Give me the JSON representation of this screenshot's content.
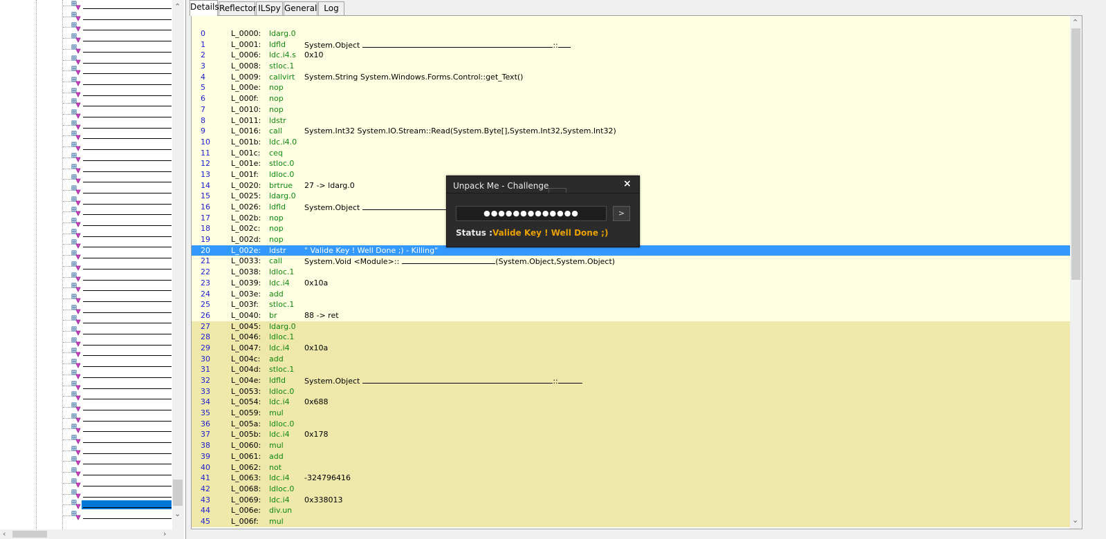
{
  "tabs": [
    {
      "label": "Details",
      "active": true
    },
    {
      "label": "Reflector",
      "active": false
    },
    {
      "label": "ILSpy",
      "active": false
    },
    {
      "label": "General",
      "active": false
    },
    {
      "label": "Log",
      "active": false
    }
  ],
  "tree": {
    "node_icon": "method-icon",
    "node_count": 48,
    "selected_index": 46
  },
  "colors": {
    "first_block": "#ffffe1",
    "second_block": "#eee8aa",
    "selected_row": "#3399ff",
    "opcode": "#118811",
    "index": "#1b1bd0",
    "status_value": "#e8a000"
  },
  "il_rows": [
    {
      "idx": "0",
      "label": "L_0000:",
      "op": "ldarg.0",
      "arg": ""
    },
    {
      "idx": "1",
      "label": "L_0001:",
      "op": "ldfld",
      "arg": "System.Object",
      "redact": [
        275,
        "::",
        18
      ]
    },
    {
      "idx": "2",
      "label": "L_0006:",
      "op": "ldc.i4.s",
      "arg": "0x10"
    },
    {
      "idx": "3",
      "label": "L_0008:",
      "op": "stloc.1",
      "arg": ""
    },
    {
      "idx": "4",
      "label": "L_0009:",
      "op": "callvirt",
      "arg": "System.String System.Windows.Forms.Control::get_Text()"
    },
    {
      "idx": "5",
      "label": "L_000e:",
      "op": "nop",
      "arg": ""
    },
    {
      "idx": "6",
      "label": "L_000f:",
      "op": "nop",
      "arg": ""
    },
    {
      "idx": "7",
      "label": "L_0010:",
      "op": "nop",
      "arg": ""
    },
    {
      "idx": "8",
      "label": "L_0011:",
      "op": "ldstr",
      "arg": ""
    },
    {
      "idx": "9",
      "label": "L_0016:",
      "op": "call",
      "arg": "System.Int32 System.IO.Stream::Read(System.Byte[],System.Int32,System.Int32)"
    },
    {
      "idx": "10",
      "label": "L_001b:",
      "op": "ldc.i4.0",
      "arg": ""
    },
    {
      "idx": "11",
      "label": "L_001c:",
      "op": "ceq",
      "arg": ""
    },
    {
      "idx": "12",
      "label": "L_001e:",
      "op": "stloc.0",
      "arg": ""
    },
    {
      "idx": "13",
      "label": "L_001f:",
      "op": "ldloc.0",
      "arg": ""
    },
    {
      "idx": "14",
      "label": "L_0020:",
      "op": "brtrue",
      "arg": "27 -> ldarg.0"
    },
    {
      "idx": "15",
      "label": "L_0025:",
      "op": "ldarg.0",
      "arg": ""
    },
    {
      "idx": "16",
      "label": "L_0026:",
      "op": "ldfld",
      "arg": "System.Object",
      "redact": [
        140,
        "",
        0
      ]
    },
    {
      "idx": "17",
      "label": "L_002b:",
      "op": "nop",
      "arg": ""
    },
    {
      "idx": "18",
      "label": "L_002c:",
      "op": "nop",
      "arg": ""
    },
    {
      "idx": "19",
      "label": "L_002d:",
      "op": "nop",
      "arg": ""
    },
    {
      "idx": "20",
      "label": "L_002e:",
      "op": "ldstr",
      "arg": "\"   Valide Key ! Well Done ;) - Killing\"",
      "selected": true
    },
    {
      "idx": "21",
      "label": "L_0033:",
      "op": "call",
      "arg": "System.Void <Module>::",
      "redact": [
        135,
        "(System.Object,System.Object)",
        0
      ]
    },
    {
      "idx": "22",
      "label": "L_0038:",
      "op": "ldloc.1",
      "arg": ""
    },
    {
      "idx": "23",
      "label": "L_0039:",
      "op": "ldc.i4",
      "arg": "0x10a"
    },
    {
      "idx": "24",
      "label": "L_003e:",
      "op": "add",
      "arg": ""
    },
    {
      "idx": "25",
      "label": "L_003f:",
      "op": "stloc.1",
      "arg": ""
    },
    {
      "idx": "26",
      "label": "L_0040:",
      "op": "br",
      "arg": "88 -> ret"
    },
    {
      "idx": "27",
      "label": "L_0045:",
      "op": "ldarg.0",
      "arg": "",
      "block2": true
    },
    {
      "idx": "28",
      "label": "L_0046:",
      "op": "ldloc.1",
      "arg": "",
      "block2": true
    },
    {
      "idx": "29",
      "label": "L_0047:",
      "op": "ldc.i4",
      "arg": "0x10a",
      "block2": true
    },
    {
      "idx": "30",
      "label": "L_004c:",
      "op": "add",
      "arg": "",
      "block2": true
    },
    {
      "idx": "31",
      "label": "L_004d:",
      "op": "stloc.1",
      "arg": "",
      "block2": true
    },
    {
      "idx": "32",
      "label": "L_004e:",
      "op": "ldfld",
      "arg": "System.Object",
      "redact": [
        275,
        "::",
        35
      ],
      "block2": true
    },
    {
      "idx": "33",
      "label": "L_0053:",
      "op": "ldloc.0",
      "arg": "",
      "block2": true
    },
    {
      "idx": "34",
      "label": "L_0054:",
      "op": "ldc.i4",
      "arg": "0x688",
      "block2": true
    },
    {
      "idx": "35",
      "label": "L_0059:",
      "op": "mul",
      "arg": "",
      "block2": true
    },
    {
      "idx": "36",
      "label": "L_005a:",
      "op": "ldloc.0",
      "arg": "",
      "block2": true
    },
    {
      "idx": "37",
      "label": "L_005b:",
      "op": "ldc.i4",
      "arg": "0x178",
      "block2": true
    },
    {
      "idx": "38",
      "label": "L_0060:",
      "op": "mul",
      "arg": "",
      "block2": true
    },
    {
      "idx": "39",
      "label": "L_0061:",
      "op": "add",
      "arg": "",
      "block2": true
    },
    {
      "idx": "40",
      "label": "L_0062:",
      "op": "not",
      "arg": "",
      "block2": true
    },
    {
      "idx": "41",
      "label": "L_0063:",
      "op": "ldc.i4",
      "arg": "-324796416",
      "block2": true
    },
    {
      "idx": "42",
      "label": "L_0068:",
      "op": "ldloc.0",
      "arg": "",
      "block2": true
    },
    {
      "idx": "43",
      "label": "L_0069:",
      "op": "ldc.i4",
      "arg": "0x338013",
      "block2": true
    },
    {
      "idx": "44",
      "label": "L_006e:",
      "op": "div.un",
      "arg": "",
      "block2": true
    },
    {
      "idx": "45",
      "label": "L_006f:",
      "op": "mul",
      "arg": "",
      "block2": true
    }
  ],
  "dialog": {
    "title": "Unpack Me - Challenge",
    "close": "×",
    "input_value": "●●●●●●●●●●●●●",
    "go_label": ">",
    "status_label": "Status :",
    "status_value": "Valide Key ! Well Done ;)"
  }
}
